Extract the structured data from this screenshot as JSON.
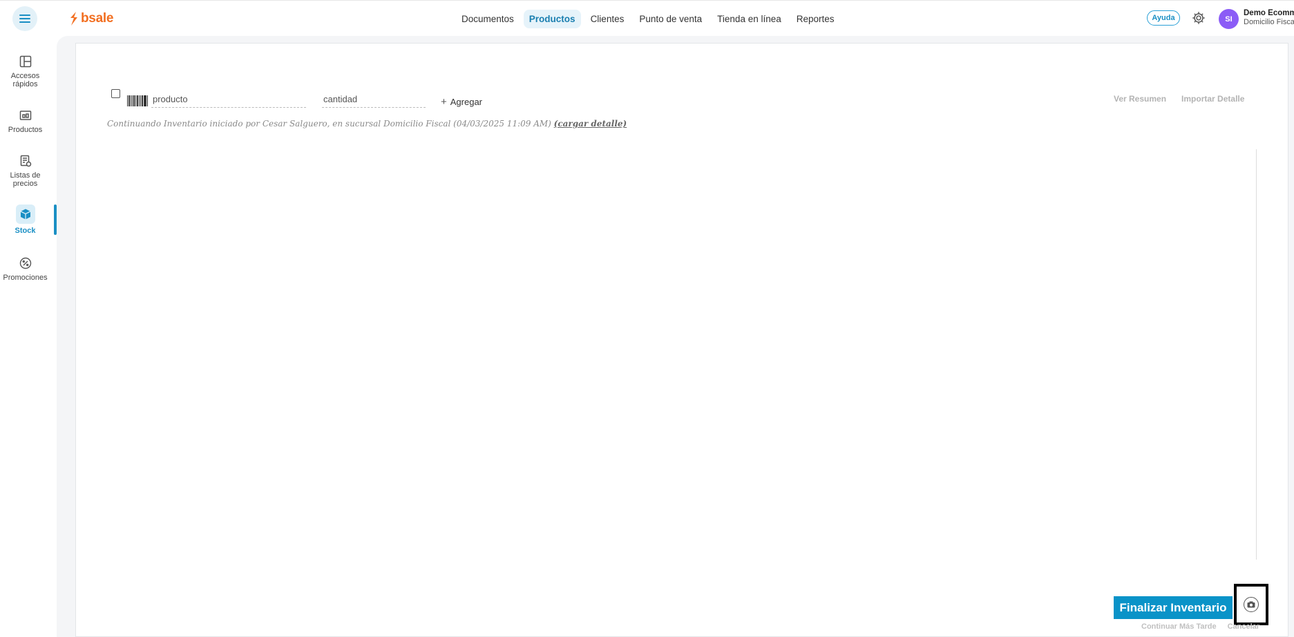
{
  "brand": {
    "name": "bsale",
    "color": "#f26f21"
  },
  "nav": {
    "items": [
      {
        "label": "Documentos"
      },
      {
        "label": "Productos",
        "active": true
      },
      {
        "label": "Clientes"
      },
      {
        "label": "Punto de venta"
      },
      {
        "label": "Tienda en línea"
      },
      {
        "label": "Reportes"
      }
    ]
  },
  "header": {
    "help_label": "Ayuda",
    "avatar_initials": "SI",
    "user_name": "Demo Ecomm",
    "user_branch": "Domicilio Fisca"
  },
  "sidebar": {
    "items": [
      {
        "label_1": "Accesos",
        "label_2": "rápidos",
        "icon": "layout-icon"
      },
      {
        "label_1": "Productos",
        "label_2": "",
        "icon": "products-icon"
      },
      {
        "label_1": "Listas de",
        "label_2": "precios",
        "icon": "price-list-icon"
      },
      {
        "label_1": "Stock",
        "label_2": "",
        "icon": "box-icon",
        "active": true
      },
      {
        "label_1": "Promociones",
        "label_2": "",
        "icon": "discount-icon"
      }
    ]
  },
  "inventory": {
    "product_placeholder": "producto",
    "quantity_placeholder": "cantidad",
    "add_label": "Agregar",
    "summary_label": "Ver Resumen",
    "import_label": "Importar Detalle",
    "note_text": "Continuando Inventario iniciado por Cesar Salguero, en sucursal Domicilio Fiscal (04/03/2025 11:09 AM)",
    "note_link": "(cargar detalle)",
    "finish_label": "Finalizar Inventario",
    "later_label": "Continuar Más Tarde",
    "cancel_label": "Cancelar"
  },
  "colors": {
    "accent": "#0a93c8",
    "avatar": "#8b5cf6"
  }
}
